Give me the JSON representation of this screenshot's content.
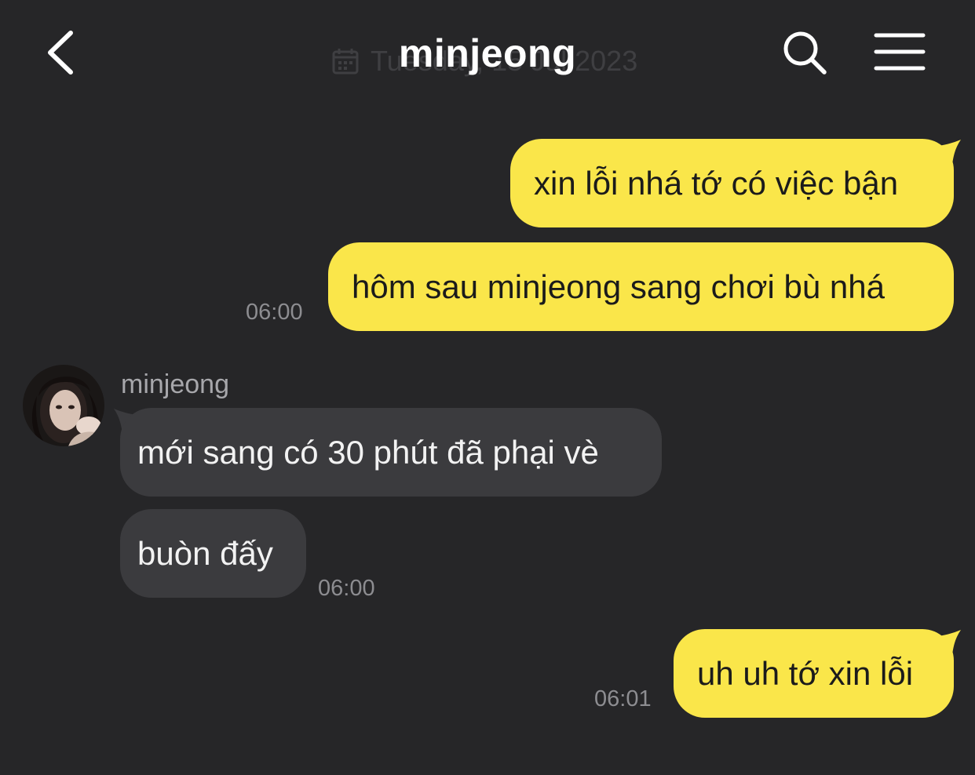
{
  "header": {
    "title": "minjeong",
    "date_label": "Tuesday, 15 Jul 2023",
    "back_icon": "chevron-left-icon",
    "search_icon": "search-icon",
    "menu_icon": "hamburger-menu-icon"
  },
  "colors": {
    "background": "#262628",
    "outgoing_bubble": "#fae64a",
    "incoming_bubble": "#3b3b3e",
    "timestamp": "#8d8d91"
  },
  "messages": {
    "m1": {
      "text": "xin lỗi nhá tớ có việc bận",
      "direction": "outgoing"
    },
    "m2": {
      "text": "hôm sau minjeong sang chơi bù nhá",
      "direction": "outgoing",
      "time": "06:00"
    },
    "m3": {
      "sender": "minjeong",
      "text": "mới sang có 30 phút đã phại vè",
      "direction": "incoming"
    },
    "m4": {
      "text": "buòn đấy",
      "direction": "incoming",
      "time": "06:00"
    },
    "m5": {
      "text": "uh uh tớ xin lỗi",
      "direction": "outgoing",
      "time": "06:01"
    }
  }
}
